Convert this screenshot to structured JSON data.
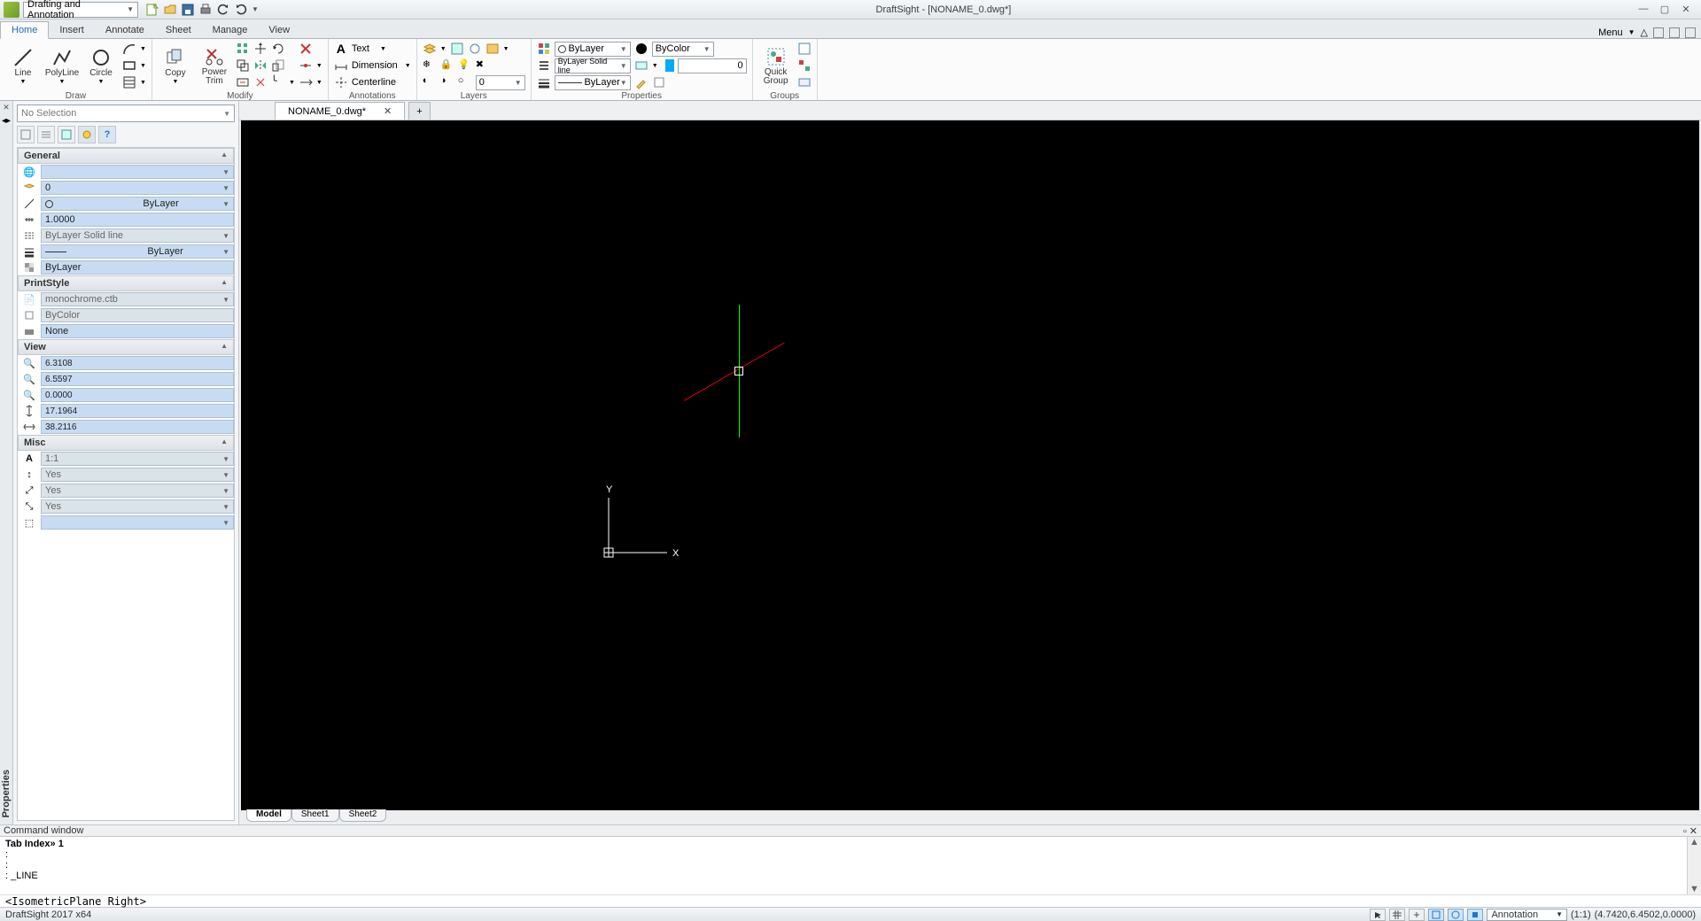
{
  "app": {
    "title": "DraftSight - [NONAME_0.dwg*]",
    "workspace": "Drafting and Annotation",
    "menu_label": "Menu"
  },
  "tabs": {
    "items": [
      "Home",
      "Insert",
      "Annotate",
      "Sheet",
      "Manage",
      "View"
    ],
    "active": 0
  },
  "ribbon": {
    "draw": {
      "label": "Draw",
      "line": "Line",
      "polyline": "PolyLine",
      "circle": "Circle"
    },
    "modify": {
      "label": "Modify",
      "copy": "Copy",
      "powertrim": "Power\nTrim"
    },
    "annotations": {
      "label": "Annotations",
      "text": "Text",
      "dimension": "Dimension",
      "centerline": "Centerline"
    },
    "layers": {
      "label": "Layers",
      "field": "0"
    },
    "properties": {
      "label": "Properties",
      "color": "ByLayer",
      "linestyle": "ByLayer    Solid line",
      "lineweight": "ByLayer",
      "bycolor": "ByColor",
      "lw_value": "0"
    },
    "groups": {
      "label": "Groups",
      "quickgroup": "Quick\nGroup"
    }
  },
  "fileTab": {
    "name": "NONAME_0.dwg*"
  },
  "propsPanel": {
    "selectLabel": "No Selection",
    "sections": {
      "general": {
        "title": "General",
        "color": "",
        "layer": "0",
        "linecolor": "ByLayer",
        "scale": "1.0000",
        "linestyle": "ByLayer    Solid line",
        "lineweight": "ByLayer",
        "transparency": "ByLayer"
      },
      "printstyle": {
        "title": "PrintStyle",
        "table": "monochrome.ctb",
        "mode": "ByColor",
        "plot": "None"
      },
      "view": {
        "title": "View",
        "v1": "6.3108",
        "v2": "6.5597",
        "v3": "0.0000",
        "v4": "17.1964",
        "v5": "38.2116"
      },
      "misc": {
        "title": "Misc",
        "m1": "1:1",
        "m2": "Yes",
        "m3": "Yes",
        "m4": "Yes",
        "m5": ""
      }
    }
  },
  "sheetTabs": [
    "Model",
    "Sheet1",
    "Sheet2"
  ],
  "cmd": {
    "header": "Command window",
    "line1": "Tab Index» 1",
    "line2": ":",
    "line3": ":",
    "line4": ": _LINE",
    "iso": "<IsometricPlane Right>"
  },
  "status": {
    "version": "DraftSight 2017 x64",
    "annot": "Annotation",
    "scale": "(1:1)",
    "coords": "(4.7420,6.4502,0.0000)"
  },
  "ucs": {
    "x": "X",
    "y": "Y"
  }
}
